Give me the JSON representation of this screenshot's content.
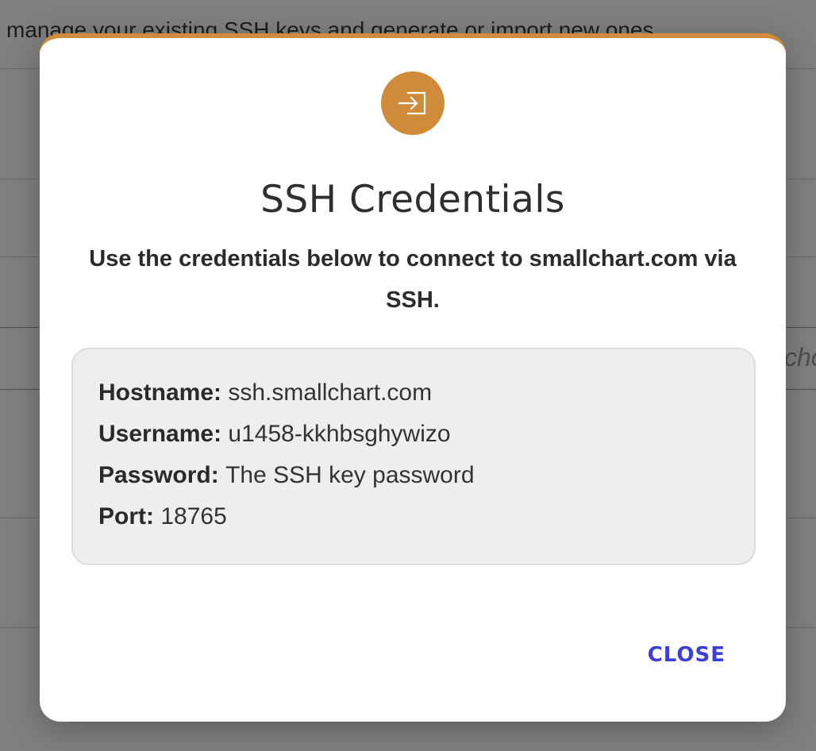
{
  "background": {
    "intro_text": "manage your existing SSH keys and generate or import new ones.",
    "partial_text": "cho"
  },
  "modal": {
    "icon": "sign-in-icon",
    "accent_color": "#cf8b3a",
    "title": "SSH Credentials",
    "subtitle": "Use the credentials below to connect to smallchart.com via SSH.",
    "credentials": [
      {
        "label": "Hostname:",
        "value": "ssh.smallchart.com"
      },
      {
        "label": "Username:",
        "value": "u1458-kkhbsghywizo"
      },
      {
        "label": "Password:",
        "value": "The SSH key password"
      },
      {
        "label": "Port:",
        "value": "18765"
      }
    ],
    "close_label": "CLOSE",
    "close_color": "#3b3fd8"
  }
}
